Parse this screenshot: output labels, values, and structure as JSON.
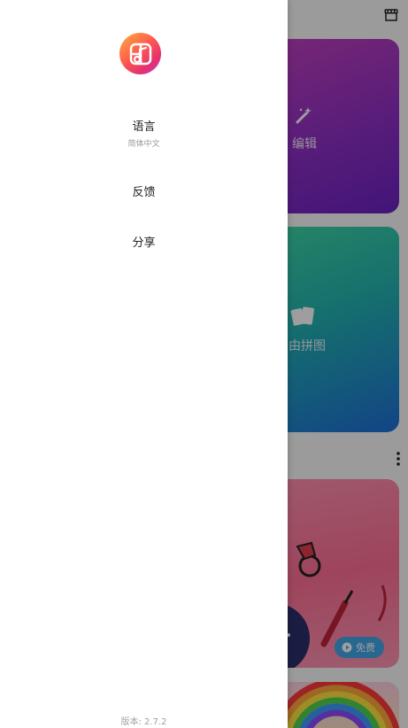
{
  "background_app": {
    "cards": [
      {
        "label": "编辑",
        "icon": "magic-wand-icon"
      },
      {
        "label": "自由拼图",
        "icon": "cards-icon"
      }
    ],
    "promo": {
      "badge_label": "免费",
      "icon": "play-icon"
    },
    "top_icon": "store-icon",
    "section_menu_icon": "more-vertical-icon"
  },
  "drawer": {
    "logo_icon": "app-logo-icon",
    "items": [
      {
        "label": "语言",
        "subtitle": "简体中文"
      },
      {
        "label": "反馈"
      },
      {
        "label": "分享"
      }
    ],
    "version": "版本: 2.7.2"
  },
  "colors": {
    "scrim": "#000000",
    "edit_card": "#9a2fc6",
    "collage_card": "#25b3b0",
    "promo_card": "#ff7a9c",
    "free_badge": "#3fa7e8"
  }
}
